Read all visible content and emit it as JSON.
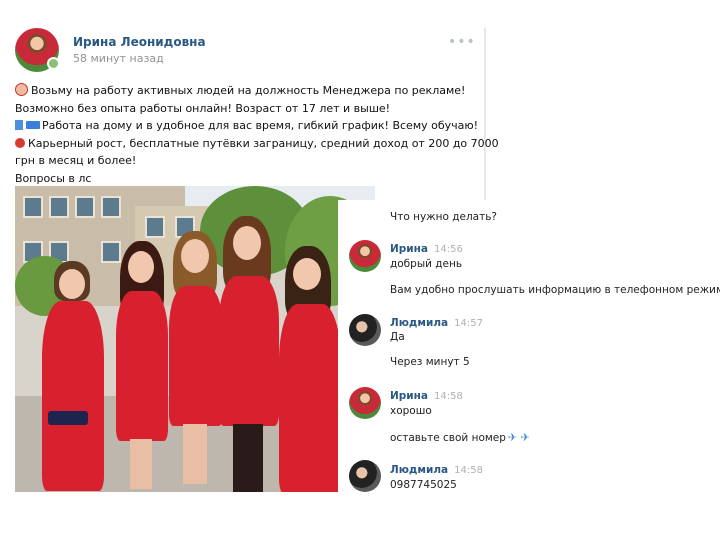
{
  "post": {
    "author": "Ирина Леонидовна",
    "time": "58 минут назад",
    "menu_icon": "more-dots-icon",
    "lines": [
      "Возьму на работу активных людей на должность Менеджера по рекламе!",
      "Возможно без опыта работы онлайн! Возраст от 17 лет и выше!",
      "Работа на дому и в удобное для вас время, гибкий график! Всему обучаю!",
      "Карьерный рост, бесплатные путёвки заграницу, средний доход от 200 до 7000",
      "грн в месяц и более!",
      "Вопросы в лс"
    ],
    "link_color": "#2a5885"
  },
  "chat": {
    "top_message": "Что нужно делать?",
    "blocks": [
      {
        "author": "Ирина",
        "time": "14:56",
        "messages": [
          "добрый день",
          "Вам удобно прослушать информацию в телефонном режиме?"
        ]
      },
      {
        "author": "Людмила",
        "time": "14:57",
        "messages": [
          "Да",
          "Через минут 5"
        ]
      },
      {
        "author": "Ирина",
        "time": "14:58",
        "messages": [
          "хорошо",
          "оставьте свой номер"
        ]
      },
      {
        "author": "Людмила",
        "time": "14:58",
        "messages": [
          "0987745025"
        ]
      }
    ],
    "plane_icons": "✈ ✈"
  }
}
